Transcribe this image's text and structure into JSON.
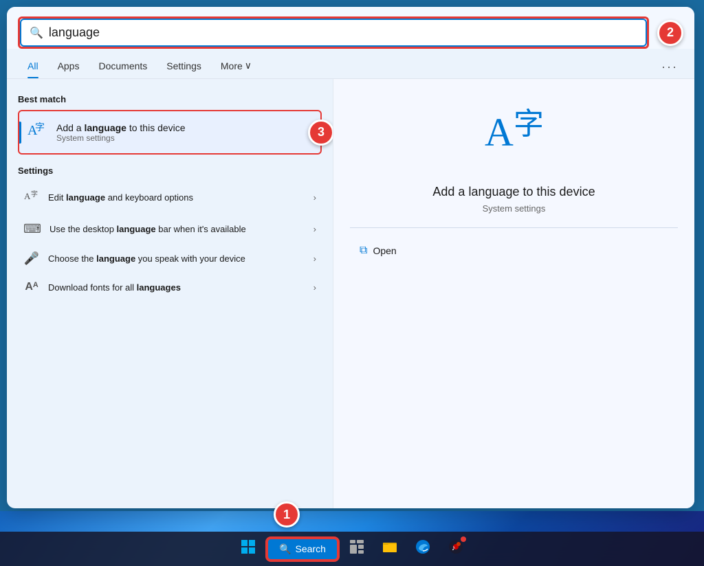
{
  "search": {
    "input_value": "language",
    "placeholder": "Search",
    "icon": "🔍"
  },
  "tabs": [
    {
      "id": "all",
      "label": "All",
      "active": true
    },
    {
      "id": "apps",
      "label": "Apps",
      "active": false
    },
    {
      "id": "documents",
      "label": "Documents",
      "active": false
    },
    {
      "id": "settings",
      "label": "Settings",
      "active": false
    },
    {
      "id": "more",
      "label": "More ∨",
      "active": false
    }
  ],
  "steps": {
    "step1": "1",
    "step2": "2",
    "step3": "3"
  },
  "best_match": {
    "label": "Best match",
    "title_plain": "Add a ",
    "title_bold": "language",
    "title_suffix": " to this device",
    "subtitle": "System settings",
    "icon": "字"
  },
  "settings_section": {
    "label": "Settings",
    "items": [
      {
        "icon": "字",
        "text_plain": "Edit ",
        "text_bold": "language",
        "text_suffix": " and keyboard options"
      },
      {
        "icon": "⌨",
        "text_plain": "Use the desktop ",
        "text_bold": "language",
        "text_suffix": " bar when it's available"
      },
      {
        "icon": "🎤",
        "text_plain": "Choose the ",
        "text_bold": "language",
        "text_suffix": " you speak with your device"
      },
      {
        "icon": "Aᴬ",
        "text_plain": "Download fonts for all ",
        "text_bold": "languages",
        "text_suffix": ""
      }
    ]
  },
  "right_panel": {
    "title": "Add a language to this device",
    "subtitle": "System settings",
    "open_label": "Open"
  },
  "taskbar": {
    "search_label": "Search",
    "search_icon": "🔍"
  },
  "tabs_dots": "···"
}
